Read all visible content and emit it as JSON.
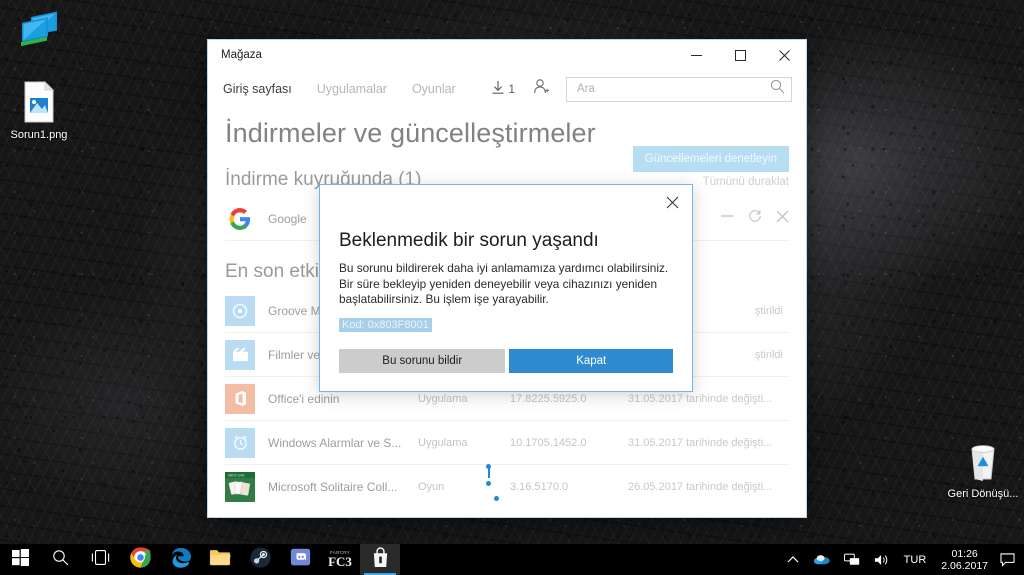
{
  "desktop": {
    "icons": [
      {
        "name": "display-settings-icon",
        "label": ""
      },
      {
        "name": "image-file-icon",
        "label": "Sorun1.png"
      },
      {
        "name": "recycle-bin-icon",
        "label": "Geri Dönüşü..."
      }
    ]
  },
  "window": {
    "title": "Mağaza",
    "controls": {
      "minimize": "─",
      "maximize": "☐",
      "close": "✕"
    },
    "nav": [
      {
        "label": "Giriş sayfası",
        "state": "active"
      },
      {
        "label": "Uygulamalar",
        "state": "inactive"
      },
      {
        "label": "Oyunlar",
        "state": "inactive"
      }
    ],
    "download_badge": "1",
    "search": {
      "placeholder": "Ara",
      "value": ""
    },
    "page_title": "İndirmeler ve güncelleştirmeler",
    "check_updates_button": "Güncellemeleri denetleyin",
    "queue_section": {
      "title": "İndirme kuyruğunda (1)",
      "pause_all": "Tümünü duraklat",
      "rows": [
        {
          "name": "Google",
          "type": "",
          "version": "",
          "date": "",
          "icon": "google-icon"
        }
      ]
    },
    "recent_section": {
      "title": "En son etkin",
      "rows": [
        {
          "name": "Groove M",
          "type": "",
          "version": "",
          "date": "ştirildi",
          "icon": "groove-music-icon"
        },
        {
          "name": "Filmler ve",
          "type": "",
          "version": "",
          "date": "ştirildi",
          "icon": "movies-tv-icon"
        },
        {
          "name": "Office'i edinin",
          "type": "Uygulama",
          "version": "17.8225.5925.0",
          "date": "31.05.2017 tarihinde değişti...",
          "icon": "office-icon"
        },
        {
          "name": "Windows Alarmlar ve S...",
          "type": "Uygulama",
          "version": "10.1705.1452.0",
          "date": "31.05.2017 tarihinde değişti...",
          "icon": "alarms-clock-icon"
        },
        {
          "name": "Microsoft Solitaire Coll...",
          "type": "Oyun",
          "version": "3.16.5170.0",
          "date": "26.05.2017 tarihinde değişti...",
          "icon": "solitaire-icon"
        }
      ]
    }
  },
  "dialog": {
    "title": "Beklenmedik bir sorun yaşandı",
    "body": "Bu sorunu bildirerek daha iyi anlamamıza yardımcı olabilirsiniz. Bir süre bekleyip yeniden deneyebilir veya cihazınızı yeniden başlatabilirsiniz. Bu işlem işe yarayabilir.",
    "code": "Kod: 0x803F8001",
    "report_button": "Bu sorunu bildir",
    "close_button": "Kapat",
    "close_icon": "✕"
  },
  "taskbar": {
    "items": [
      {
        "name": "start-button",
        "icon": "windows-logo-icon",
        "active": false
      },
      {
        "name": "search-button",
        "icon": "search-icon",
        "active": false
      },
      {
        "name": "task-view-button",
        "icon": "task-view-icon",
        "active": false
      },
      {
        "name": "chrome-button",
        "icon": "chrome-icon",
        "active": false
      },
      {
        "name": "edge-button",
        "icon": "edge-icon",
        "active": false
      },
      {
        "name": "file-explorer-button",
        "icon": "folder-icon",
        "active": false
      },
      {
        "name": "steam-button",
        "icon": "steam-icon",
        "active": false
      },
      {
        "name": "discord-button",
        "icon": "discord-icon",
        "active": false
      },
      {
        "name": "farcry3-button",
        "icon": "fc3-icon",
        "label": "FC3",
        "active": false
      },
      {
        "name": "store-button",
        "icon": "store-icon",
        "active": true
      }
    ],
    "tray": {
      "show_hidden": "∧",
      "language": "TUR",
      "time": "01:26",
      "date": "2.06.2017"
    }
  },
  "colors": {
    "accent_blue": "#2e8bd0",
    "dialog_border": "#72b6e8",
    "selection_blue": "#a8cfe9",
    "check_updates_bg": "#b7ddf3",
    "taskbar_bg": "#000000"
  }
}
